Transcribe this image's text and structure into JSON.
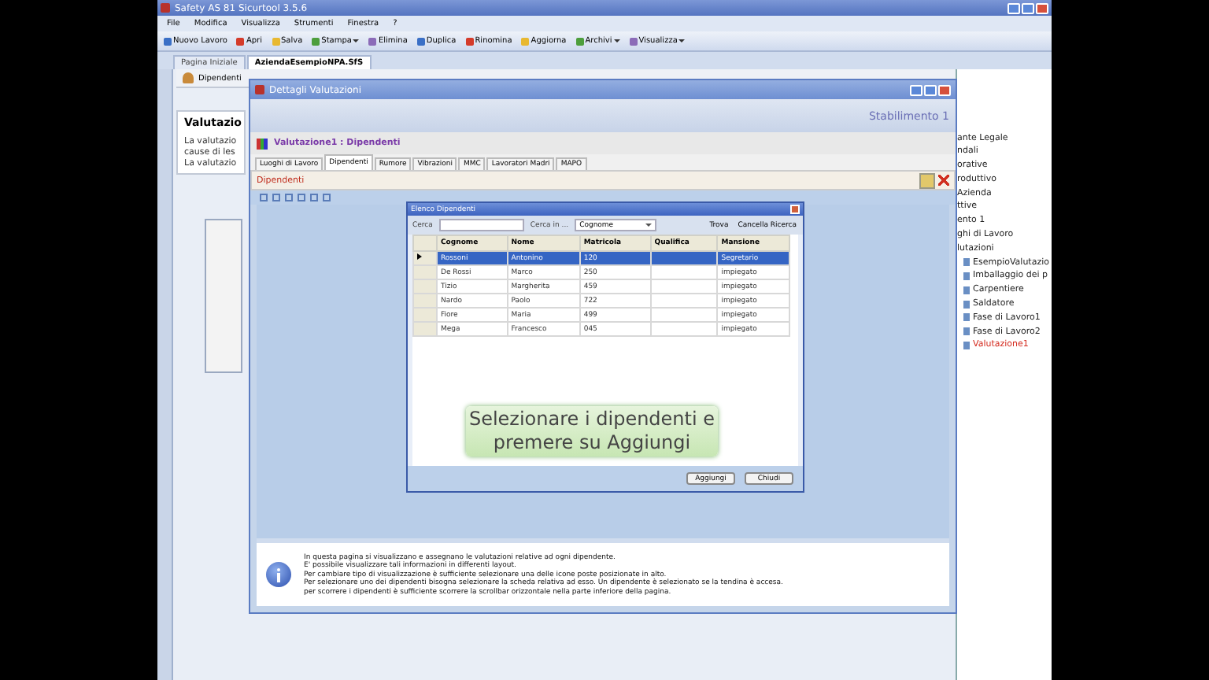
{
  "app": {
    "title": "Safety AS 81 Sicurtool 3.5.6"
  },
  "menu": [
    "File",
    "Modifica",
    "Visualizza",
    "Strumenti",
    "Finestra",
    "?"
  ],
  "toolbar": [
    {
      "label": "Nuovo Lavoro",
      "dropdown": false
    },
    {
      "label": "Apri",
      "dropdown": false
    },
    {
      "label": "Salva",
      "dropdown": false
    },
    {
      "label": "Stampa",
      "dropdown": true
    },
    {
      "label": "Elimina",
      "dropdown": false
    },
    {
      "label": "Duplica",
      "dropdown": false
    },
    {
      "label": "Rinomina",
      "dropdown": false
    },
    {
      "label": "Aggiorna",
      "dropdown": false
    },
    {
      "label": "Archivi",
      "dropdown": true
    },
    {
      "label": "Visualizza",
      "dropdown": true
    }
  ],
  "doc_tabs": [
    {
      "label": "Pagina Iniziale",
      "selected": false
    },
    {
      "label": "AziendaEsempioNPA.SfS",
      "selected": true
    }
  ],
  "page_tab": "Dipendenti",
  "left_panel": {
    "heading": "Valutazio",
    "lines": [
      "La valutazio",
      "cause di les",
      "La valutazio"
    ]
  },
  "tree": [
    {
      "label": "ante Legale",
      "selected": false
    },
    {
      "label": "ndali",
      "selected": false
    },
    {
      "label": "orative",
      "selected": false
    },
    {
      "label": "roduttivo",
      "selected": false
    },
    {
      "label": "Azienda",
      "selected": false
    },
    {
      "label": "ttive",
      "selected": false
    },
    {
      "label": "ento 1",
      "selected": false
    },
    {
      "label": "ghi di Lavoro",
      "selected": false
    },
    {
      "label": "lutazioni",
      "selected": false,
      "children": [
        {
          "label": "EsempioValutazio",
          "selected": false
        },
        {
          "label": "Imballaggio dei p",
          "selected": false
        },
        {
          "label": "Carpentiere",
          "selected": false
        },
        {
          "label": "Saldatore",
          "selected": false
        },
        {
          "label": "Fase di Lavoro1",
          "selected": false
        },
        {
          "label": "Fase di Lavoro2",
          "selected": false
        },
        {
          "label": "Valutazione1",
          "selected": true
        }
      ]
    }
  ],
  "dialog": {
    "title": "Dettagli Valutazioni",
    "location": "Stabilimento 1",
    "heading": "Valutazione1 : Dipendenti",
    "tabs": [
      {
        "label": "Luoghi di Lavoro",
        "selected": false
      },
      {
        "label": "Dipendenti",
        "selected": true
      },
      {
        "label": "Rumore",
        "selected": false
      },
      {
        "label": "Vibrazioni",
        "selected": false
      },
      {
        "label": "MMC",
        "selected": false
      },
      {
        "label": "Lavoratori Madri",
        "selected": false
      },
      {
        "label": "MAPO",
        "selected": false
      }
    ],
    "section": "Dipendenti"
  },
  "picker": {
    "title": "Elenco Dipendenti",
    "search_label": "Cerca",
    "search_in_label": "Cerca in ...",
    "search_in_value": "Cognome",
    "find": "Trova",
    "clear": "Cancella Ricerca",
    "columns": [
      "Cognome",
      "Nome",
      "Matricola",
      "Qualifica",
      "Mansione"
    ],
    "rows": [
      {
        "cells": [
          "Rossoni",
          "Antonino",
          "120",
          "",
          "Segretario"
        ],
        "selected": true
      },
      {
        "cells": [
          "De Rossi",
          "Marco",
          "250",
          "",
          "impiegato"
        ],
        "selected": false
      },
      {
        "cells": [
          "Tizio",
          "Margherita",
          "459",
          "",
          "impiegato"
        ],
        "selected": false
      },
      {
        "cells": [
          "Nardo",
          "Paolo",
          "722",
          "",
          "impiegato"
        ],
        "selected": false
      },
      {
        "cells": [
          "Fiore",
          "Maria",
          "499",
          "",
          "impiegato"
        ],
        "selected": false
      },
      {
        "cells": [
          "Mega",
          "Francesco",
          "045",
          "",
          "impiegato"
        ],
        "selected": false
      }
    ],
    "buttons": [
      "Aggiungi",
      "Chiudi"
    ]
  },
  "callout": "Selezionare i dipendenti e premere su Aggiungi",
  "info": [
    "In questa pagina si visualizzano e assegnano le valutazioni relative ad ogni dipendente.",
    "E' possibile visualizzare tali informazioni in differenti layout.",
    "Per cambiare tipo di visualizzazione è sufficiente selezionare una delle icone poste posizionate in alto.",
    "Per selezionare uno dei dipendenti bisogna selezionare la scheda relativa ad esso. Un dipendente è selezionato se la tendina è accesa.",
    "per scorrere i dipendenti è sufficiente scorrere la scrollbar orizzontale nella parte inferiore della pagina."
  ]
}
